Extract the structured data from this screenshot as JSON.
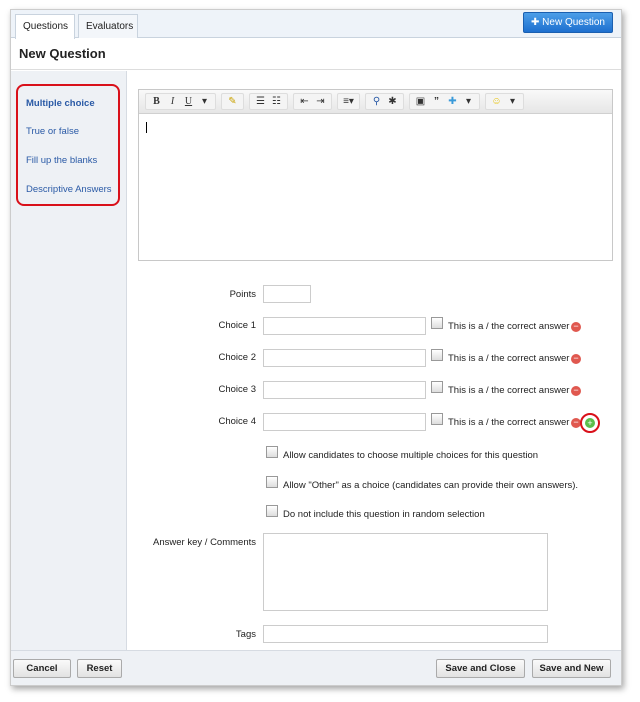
{
  "tabs": [
    {
      "label": "Questions"
    },
    {
      "label": "Evaluators"
    }
  ],
  "new_question_button": "New Question",
  "page_title": "New Question",
  "sidebar": {
    "items": [
      {
        "label": "Multiple choice"
      },
      {
        "label": "True or false"
      },
      {
        "label": "Fill up the blanks"
      },
      {
        "label": "Descriptive Answers"
      }
    ]
  },
  "toolbar": {
    "bold": "B",
    "italic": "I",
    "underline": "U",
    "quote": "”"
  },
  "form": {
    "points_label": "Points",
    "choices": [
      {
        "label": "Choice 1"
      },
      {
        "label": "Choice 2"
      },
      {
        "label": "Choice 3"
      },
      {
        "label": "Choice 4"
      }
    ],
    "correct_label": "This is a / the correct answer",
    "options": [
      "Allow candidates to choose multiple choices for this question",
      "Allow \"Other\" as a choice (candidates can provide their own answers).",
      "Do not include this question in random selection"
    ],
    "answer_key_label": "Answer key / Comments",
    "tags_label": "Tags"
  },
  "footer": {
    "cancel": "Cancel",
    "reset": "Reset",
    "save_close": "Save and Close",
    "save_new": "Save and New"
  }
}
